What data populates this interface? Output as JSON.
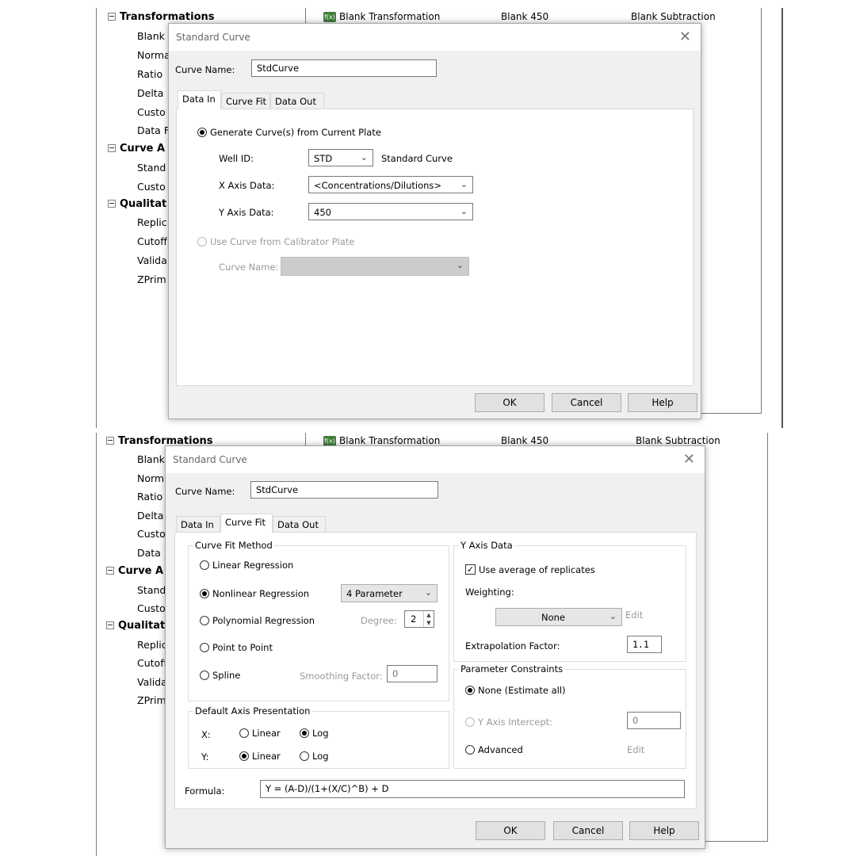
{
  "background": {
    "tree": {
      "transformations": "Transformations",
      "blank": "Blank",
      "norma": "Norma",
      "ratio": "Ratio",
      "delta": "Delta",
      "custom1": "Custo",
      "data_f": "Data F",
      "curve_a": "Curve A",
      "stand": "Stand",
      "custom2": "Custo",
      "qualitat": "Qualitat",
      "replic": "Replic",
      "cutoff": "Cutoff",
      "valida": "Valida",
      "zprim": "ZPrim"
    },
    "row": {
      "icon": "f(x)",
      "name": "Blank Transformation",
      "column2": "Blank 450",
      "column3": "Blank Subtraction"
    }
  },
  "dialog": {
    "title": "Standard Curve",
    "close": "✕",
    "curve_name_label": "Curve Name:",
    "curve_name_value": "StdCurve",
    "tabs": [
      "Data In",
      "Curve Fit",
      "Data Out"
    ],
    "ok": "OK",
    "cancel": "Cancel",
    "help": "Help"
  },
  "data_in": {
    "generate_label": "Generate Curve(s) from Current Plate",
    "well_id_label": "Well ID:",
    "well_id_value": "STD",
    "well_id_desc": "Standard Curve",
    "x_axis_label": "X Axis Data:",
    "x_axis_value": "<Concentrations/Dilutions>",
    "y_axis_label": "Y Axis Data:",
    "y_axis_value": "450",
    "calibrator_label": "Use Curve from Calibrator Plate",
    "cal_curve_name_label": "Curve Name:"
  },
  "curve_fit": {
    "method_legend": "Curve Fit Method",
    "linear": "Linear Regression",
    "nonlinear": "Nonlinear Regression",
    "nonlinear_value": "4 Parameter",
    "polynomial": "Polynomial Regression",
    "degree_label": "Degree:",
    "degree_value": "2",
    "point_to_point": "Point to Point",
    "spline": "Spline",
    "smoothing_label": "Smoothing Factor:",
    "smoothing_value": "0",
    "axis_legend": "Default Axis Presentation",
    "x_label": "X:",
    "y_label": "Y:",
    "linear_opt": "Linear",
    "log_opt": "Log",
    "yaxis_legend": "Y Axis Data",
    "use_average": "Use average of replicates",
    "weighting_label": "Weighting:",
    "weighting_value": "None",
    "edit": "Edit",
    "extrapolation_label": "Extrapolation Factor:",
    "extrapolation_value": "1.1",
    "constraints_legend": "Parameter Constraints",
    "none_estimate": "None (Estimate all)",
    "y_intercept": "Y Axis Intercept:",
    "y_intercept_value": "0",
    "advanced": "Advanced",
    "formula_label": "Formula:",
    "formula_value": "Y = (A-D)/(1+(X/C)^B) + D"
  }
}
